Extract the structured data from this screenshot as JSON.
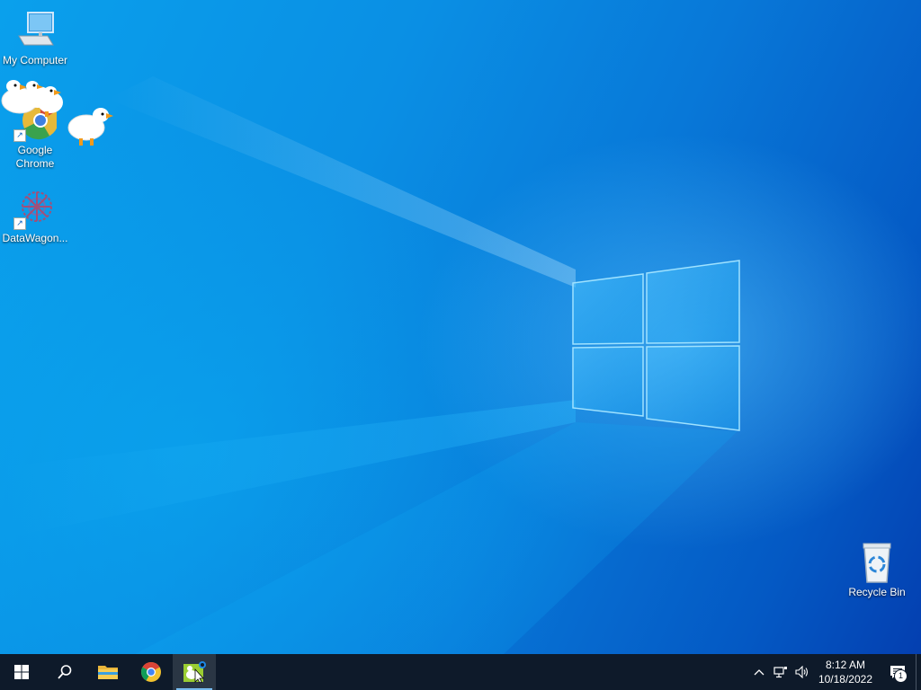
{
  "desktop": {
    "icons": [
      {
        "label": "My Computer"
      },
      {
        "label": "Google\nChrome"
      },
      {
        "label": "DataWagon..."
      },
      {
        "label": "Recycle Bin"
      }
    ]
  },
  "taskbar": {
    "start": "start-icon",
    "search": "search-icon",
    "pinned": [
      {
        "name": "file-explorer-icon"
      },
      {
        "name": "chrome-icon"
      },
      {
        "name": "desktop-goose-icon"
      }
    ]
  },
  "tray": {
    "time": "8:12 AM",
    "date": "10/18/2022",
    "notification_count": "1"
  },
  "colors": {
    "taskbar": "#0e1a2a",
    "wallpaper_accent": "#0a7ad6"
  }
}
